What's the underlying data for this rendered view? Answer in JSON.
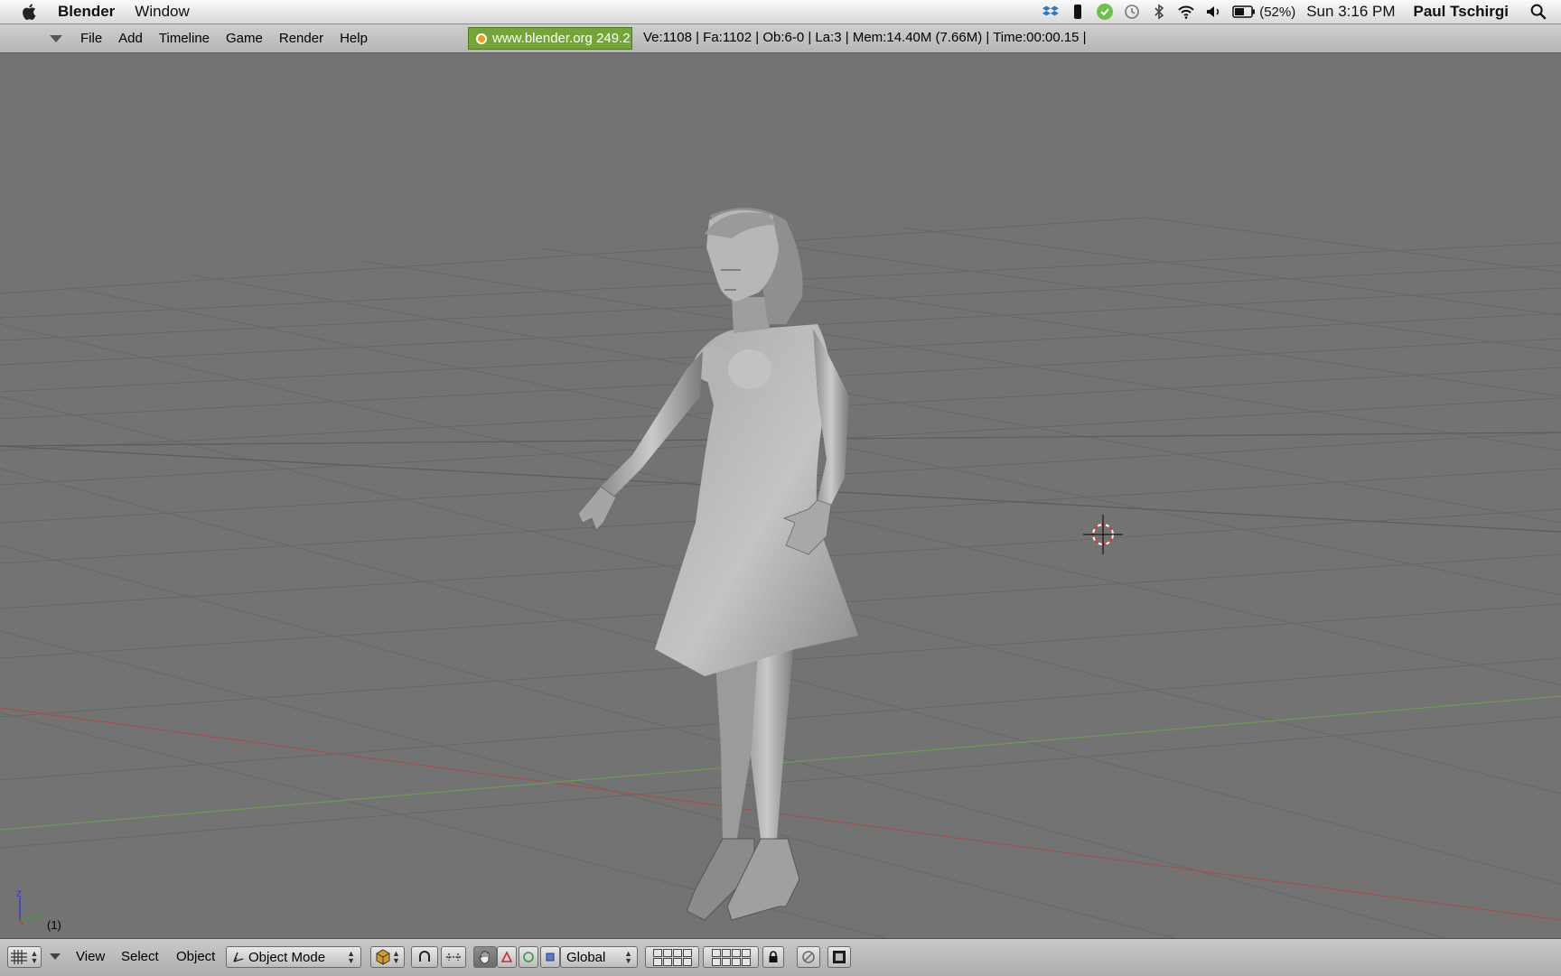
{
  "mac_menubar": {
    "app_name": "Blender",
    "menus": [
      "Window"
    ],
    "battery_percent": "(52%)",
    "clock": "Sun 3:16 PM",
    "user": "Paul Tschirgi",
    "tray_icons": [
      "dropbox-icon",
      "phone-icon",
      "evernote-icon",
      "time-machine-icon",
      "bluetooth-icon",
      "wifi-icon",
      "volume-icon",
      "battery-icon"
    ]
  },
  "blender_header": {
    "menus": [
      "File",
      "Add",
      "Timeline",
      "Game",
      "Render",
      "Help"
    ],
    "url_button": "www.blender.org 249.2",
    "stats": "Ve:1108 | Fa:1102 | Ob:6-0 | La:3  | Mem:14.40M (7.66M)  | Time:00:00.15 |"
  },
  "viewport": {
    "frame_indicator": "(1)",
    "axis_labels": {
      "z": "z",
      "y": "y"
    }
  },
  "view3d_header": {
    "menus": [
      "View",
      "Select",
      "Object"
    ],
    "mode_select": "Object Mode",
    "orientation_select": "Global"
  },
  "colors": {
    "viewport_bg": "#737373",
    "x_axis": "#a4504f",
    "y_axis": "#6e9a54",
    "url_button": "#73a636"
  }
}
